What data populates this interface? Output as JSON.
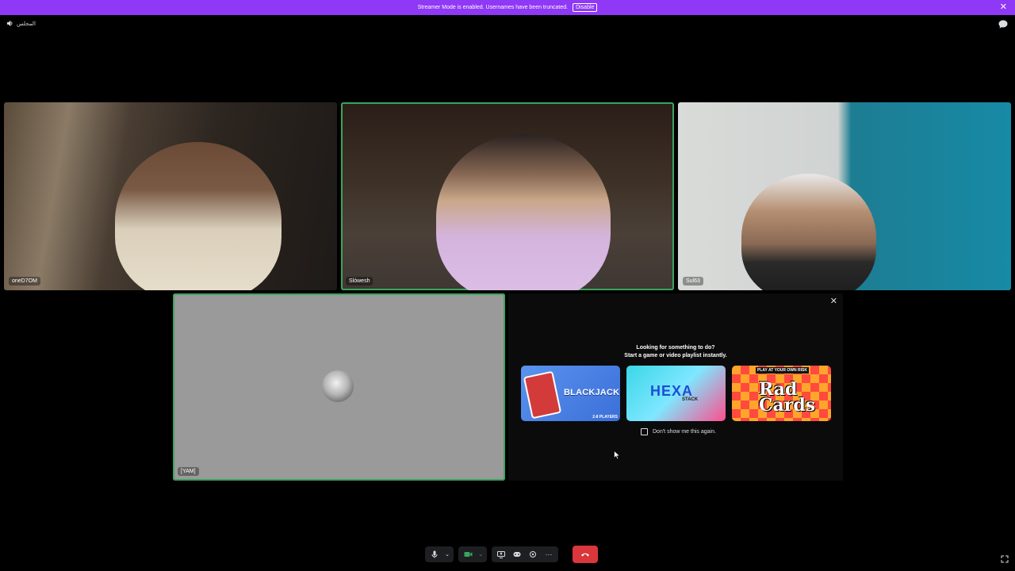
{
  "banner": {
    "message": "Streamer Mode is enabled. Usernames have been truncated.",
    "disable_label": "Disable"
  },
  "channel": {
    "name": "المجلس",
    "icon": "speaker-icon"
  },
  "tiles": [
    {
      "username": "oneD7OM"
    },
    {
      "username": "Slówesh"
    },
    {
      "username": "Sul63"
    },
    {
      "username": "[YAM]"
    }
  ],
  "activity": {
    "heading_line1": "Looking for something to do?",
    "heading_line2": "Start a game or video playlist instantly.",
    "games": [
      {
        "title": "BLACKJACK",
        "subtitle": "2-8 PLAYERS"
      },
      {
        "title": "HEXA",
        "subtitle": "STACK"
      },
      {
        "title": "Rad Cards",
        "tag": "PLAY AT YOUR OWN RISK"
      }
    ],
    "dont_show_label": "Don't show me this again."
  },
  "colors": {
    "banner": "#8f38f5",
    "speaking_border": "#3ba55d",
    "hangup": "#da373c"
  }
}
